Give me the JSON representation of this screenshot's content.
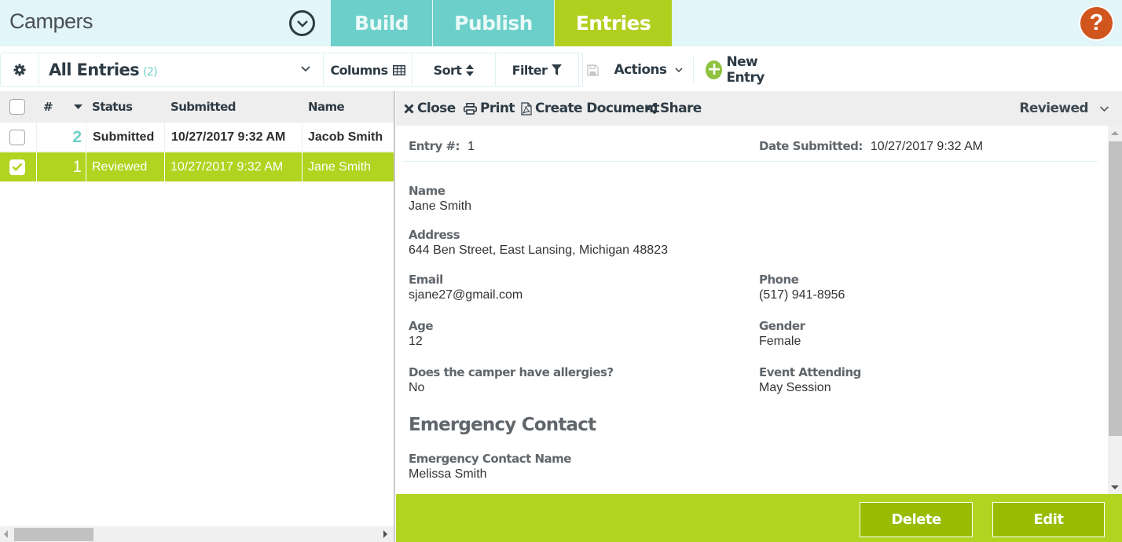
{
  "header": {
    "app_title": "Campers",
    "tabs": [
      {
        "label": "Build",
        "active": false
      },
      {
        "label": "Publish",
        "active": false
      },
      {
        "label": "Entries",
        "active": true
      }
    ],
    "help_label": "?"
  },
  "toolbar": {
    "view_label": "All Entries",
    "view_count": "(2)",
    "columns_label": "Columns",
    "sort_label": "Sort",
    "filter_label": "Filter",
    "actions_label": "Actions",
    "new_entry_label": "New Entry"
  },
  "table": {
    "columns": [
      "#",
      "Status",
      "Submitted",
      "Name"
    ],
    "rows": [
      {
        "number": "2",
        "status": "Submitted",
        "submitted": "10/27/2017 9:32 AM",
        "name": "Jacob Smith",
        "checked": false,
        "selected": false
      },
      {
        "number": "1",
        "status": "Reviewed",
        "submitted": "10/27/2017 9:32 AM",
        "name": "Jane Smith",
        "checked": true,
        "selected": true
      }
    ]
  },
  "detail": {
    "toolbar": {
      "close_label": "Close",
      "print_label": "Print",
      "create_document_label": "Create Document",
      "share_label": "Share",
      "status_value": "Reviewed"
    },
    "entry_number_label": "Entry #:",
    "entry_number": "1",
    "date_submitted_label": "Date Submitted:",
    "date_submitted": "10/27/2017 9:32 AM",
    "fields": {
      "name": {
        "label": "Name",
        "value": "Jane Smith"
      },
      "address": {
        "label": "Address",
        "value": "644 Ben Street, East Lansing, Michigan 48823"
      },
      "email": {
        "label": "Email",
        "value": "sjane27@gmail.com"
      },
      "phone": {
        "label": "Phone",
        "value": "(517) 941-8956"
      },
      "age": {
        "label": "Age",
        "value": "12"
      },
      "gender": {
        "label": "Gender",
        "value": "Female"
      },
      "allergies": {
        "label": "Does the camper have allergies?",
        "value": "No"
      },
      "event": {
        "label": "Event Attending",
        "value": "May Session"
      }
    },
    "section_title": "Emergency Contact",
    "emergency": {
      "name": {
        "label": "Emergency Contact Name",
        "value": "Melissa Smith"
      }
    }
  },
  "footer": {
    "delete_label": "Delete",
    "edit_label": "Edit"
  },
  "colors": {
    "accent_green": "#b0d41f",
    "accent_teal": "#6ccfc9",
    "help_orange": "#d0561e",
    "button_green": "#99bb00"
  }
}
